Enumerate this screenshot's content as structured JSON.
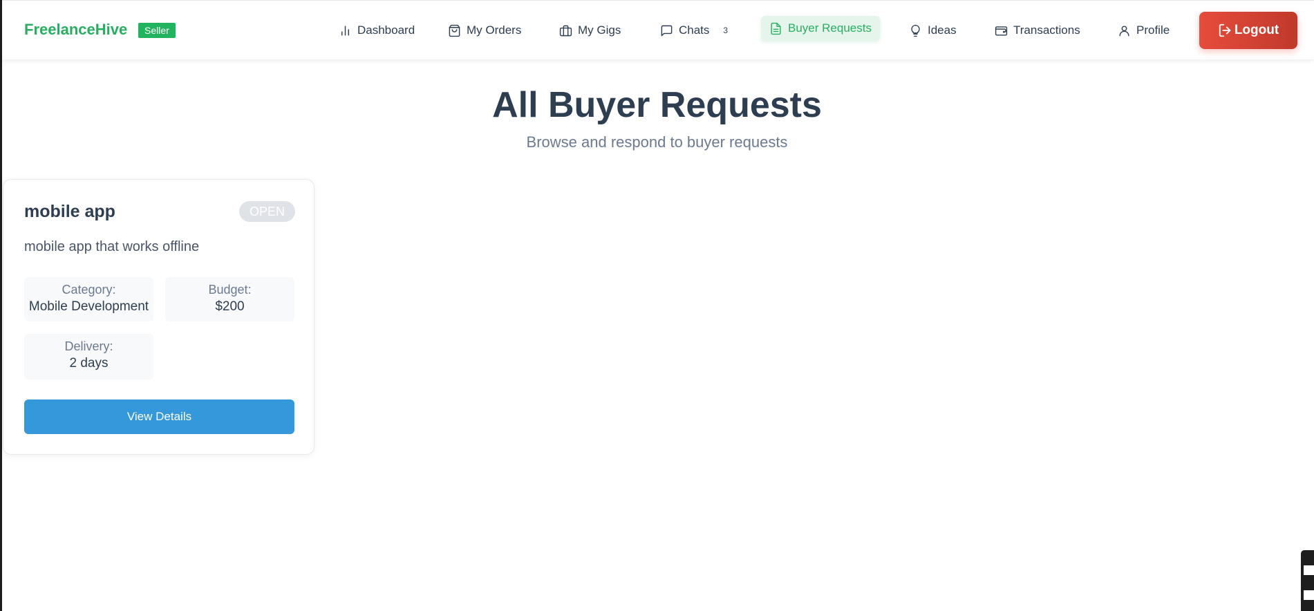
{
  "navbar": {
    "brand": "FreelanceHive",
    "role_badge": "Seller",
    "items": [
      {
        "label": "Dashboard",
        "icon": "bar-chart-icon"
      },
      {
        "label": "My Orders",
        "icon": "shopping-bag-icon"
      },
      {
        "label": "My Gigs",
        "icon": "briefcase-icon"
      },
      {
        "label": "Chats",
        "icon": "chat-bubble-icon",
        "badge": "3"
      },
      {
        "label": "Buyer Requests",
        "icon": "document-icon",
        "active": true
      },
      {
        "label": "Ideas",
        "icon": "lightbulb-icon"
      },
      {
        "label": "Transactions",
        "icon": "wallet-icon"
      },
      {
        "label": "Profile",
        "icon": "user-icon"
      }
    ],
    "logout_label": "Logout"
  },
  "header": {
    "title": "All Buyer Requests",
    "subtitle": "Browse and respond to buyer requests"
  },
  "requests": [
    {
      "title": "mobile app",
      "status": "OPEN",
      "description": "mobile app that works offline",
      "category_label": "Category:",
      "category": "Mobile Development",
      "budget_label": "Budget:",
      "budget": "$200",
      "delivery_label": "Delivery:",
      "delivery": "2 days",
      "action_label": "View Details"
    }
  ],
  "colors": {
    "brand": "#27ae60",
    "active_nav_bg": "#e5f5ec",
    "logout": "#e74c3c",
    "primary_button": "#3498db",
    "status_badge": "#dfe2e6"
  }
}
